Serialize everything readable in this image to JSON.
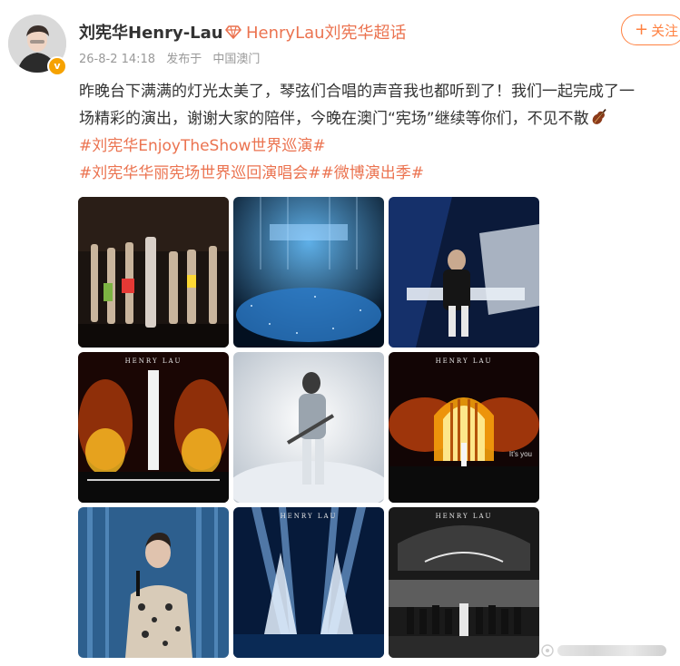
{
  "post": {
    "username": "刘宪华Henry-Lau",
    "super_topic": "HenryLau刘宪华超话",
    "date": "26-8-2 14:18",
    "source": "发布于",
    "location": "中国澳门",
    "follow_label": "关注",
    "text_line1": "昨晚台下满满的灯光太美了，琴弦们合唱的声音我也都听到了！我们一起完成了一",
    "text_line2": "场精彩的演出，谢谢大家的陪伴，今晚在澳门“宪场”继续等你们，不见不散",
    "hashtag1": "#刘宪华EnjoyTheShow世界巡演#",
    "hashtag2": "#刘宪华华丽宪场世界巡回演唱会##微博演出季#"
  },
  "photos": {
    "brand": "HENRY LAU",
    "caption6": "It's you"
  },
  "colors": {
    "accent": "#eb7350",
    "follow": "#ff8140",
    "meta": "#999999",
    "badge": "#f6a200"
  }
}
